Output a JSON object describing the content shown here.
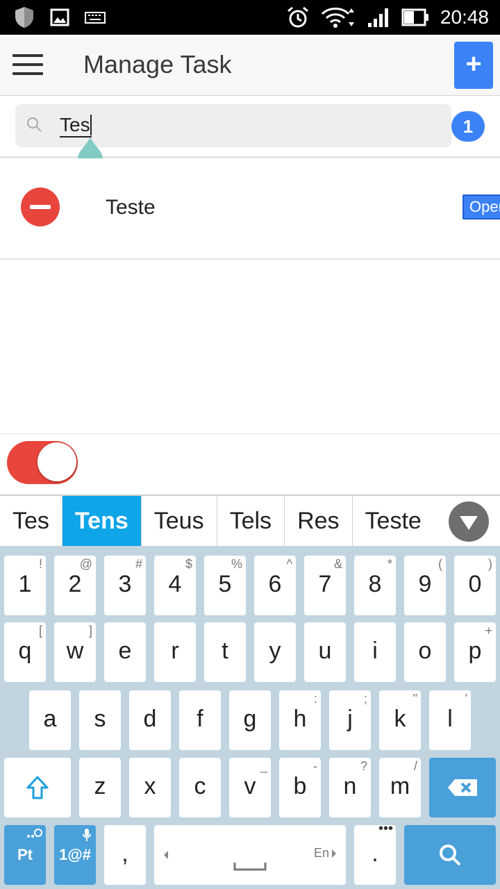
{
  "status_bar": {
    "time": "20:48"
  },
  "app_bar": {
    "title": "Manage Task",
    "add_label": "+"
  },
  "search": {
    "value": "Tes",
    "result_count": "1"
  },
  "tasks": [
    {
      "name": "Teste",
      "status": "Open"
    }
  ],
  "toggle": {
    "on": true
  },
  "keyboard": {
    "suggestions": [
      "Tes",
      "Tens",
      "Teus",
      "Tels",
      "Res",
      "Teste"
    ],
    "active_suggestion": "Tens",
    "row1": [
      [
        "1",
        "!"
      ],
      [
        "2",
        "@"
      ],
      [
        "3",
        "#"
      ],
      [
        "4",
        "$"
      ],
      [
        "5",
        "%"
      ],
      [
        "6",
        "^"
      ],
      [
        "7",
        "&"
      ],
      [
        "8",
        "*"
      ],
      [
        "9",
        "("
      ],
      [
        "0",
        ")"
      ]
    ],
    "row2": [
      [
        "q",
        "["
      ],
      [
        "w",
        "]"
      ],
      [
        "e",
        ""
      ],
      [
        "r",
        ""
      ],
      [
        "t",
        ""
      ],
      [
        "y",
        ""
      ],
      [
        "u",
        ""
      ],
      [
        "i",
        ""
      ],
      [
        "o",
        ""
      ],
      [
        "p",
        "+"
      ]
    ],
    "row3": [
      [
        "a",
        ""
      ],
      [
        "s",
        ""
      ],
      [
        "d",
        ""
      ],
      [
        "f",
        ""
      ],
      [
        "g",
        ""
      ],
      [
        "h",
        ":"
      ],
      [
        "j",
        ";"
      ],
      [
        "k",
        "\""
      ],
      [
        "l",
        "'"
      ]
    ],
    "row4": [
      [
        "z",
        ""
      ],
      [
        "x",
        ""
      ],
      [
        "c",
        ""
      ],
      [
        "v",
        "_"
      ],
      [
        "b",
        "-"
      ],
      [
        "n",
        "?"
      ],
      [
        "m",
        "/"
      ]
    ],
    "lang_key": "Pt",
    "symbols_key": "1@#",
    "comma_key": ",",
    "space_lang": "En",
    "period_key": ".",
    "accent_color": "#4aa0d9"
  },
  "colors": {
    "primary": "#3b82f6",
    "danger": "#e8453c",
    "suggestion_active": "#0ea5e9"
  }
}
